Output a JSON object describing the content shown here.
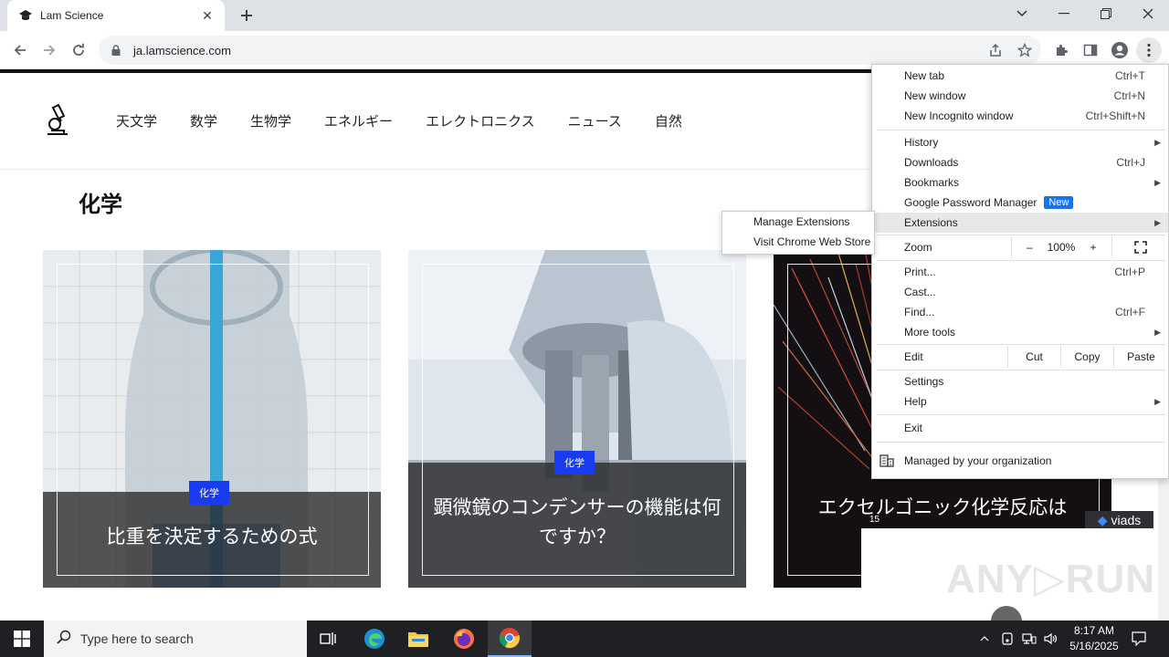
{
  "browser": {
    "tab_title": "Lam Science",
    "url": "ja.lamscience.com"
  },
  "site": {
    "nav": [
      "天文学",
      "数学",
      "生物学",
      "エネルギー",
      "エレクトロニクス",
      "ニュース",
      "自然"
    ],
    "category_title": "化学",
    "cards": [
      {
        "badge": "化学",
        "title": "比重を決定するための式"
      },
      {
        "badge": "化学",
        "title": "顕微鏡のコンデンサーの機能は何ですか？"
      },
      {
        "badge": "",
        "title": "エクセルゴニック化学反応は"
      }
    ],
    "ad_label": "viads",
    "ad_number": "15",
    "watermark": "ANY▷RUN"
  },
  "menu": {
    "new_tab": "New tab",
    "new_tab_sc": "Ctrl+T",
    "new_window": "New window",
    "new_window_sc": "Ctrl+N",
    "incognito": "New Incognito window",
    "incognito_sc": "Ctrl+Shift+N",
    "history": "History",
    "downloads": "Downloads",
    "downloads_sc": "Ctrl+J",
    "bookmarks": "Bookmarks",
    "password_manager": "Google Password Manager",
    "new_badge": "New",
    "extensions": "Extensions",
    "zoom": "Zoom",
    "zoom_minus": "–",
    "zoom_value": "100%",
    "zoom_plus": "+",
    "print": "Print...",
    "print_sc": "Ctrl+P",
    "cast": "Cast...",
    "find": "Find...",
    "find_sc": "Ctrl+F",
    "more_tools": "More tools",
    "edit": "Edit",
    "cut": "Cut",
    "copy": "Copy",
    "paste": "Paste",
    "settings": "Settings",
    "help": "Help",
    "exit": "Exit",
    "managed": "Managed by your organization"
  },
  "submenu": {
    "manage": "Manage Extensions",
    "store": "Visit Chrome Web Store"
  },
  "taskbar": {
    "search_placeholder": "Type here to search",
    "time": "8:17 AM",
    "date": "5/16/2025"
  }
}
